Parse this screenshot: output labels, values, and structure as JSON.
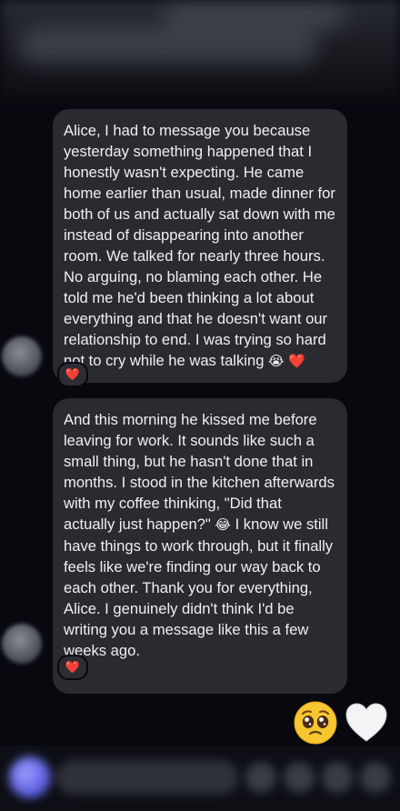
{
  "messages": [
    {
      "text": "Alice, I had to message you because yesterday something happened that I honestly wasn't expecting. He came home earlier than usual, made dinner for both of us and actually sat down with me instead of disappearing into another room. We talked for nearly three hours. No arguing, no blaming each other. He told me he'd been thinking a lot about everything and that he doesn't want our relationship to end. I was trying so hard not to cry while he was talking ",
      "trailing_emojis": [
        "😭",
        "❤️"
      ],
      "reaction": "❤️"
    },
    {
      "text_part1": "And this morning he kissed me before leaving for work. It sounds like such a small thing, but he hasn't done that in months. I stood in the kitchen afterwards with my coffee thinking, \"Did that actually just happen?\" ",
      "mid_emoji": "😂",
      "text_part2": " I know we still have things to work through, but it finally feels like we're finding our way back to each other. Thank you for everything, Alice. I genuinely didn't think I'd be writing you a message like this a few weeks ago.",
      "trailing_emoji": "❤️",
      "reaction": "❤️"
    }
  ],
  "reply_emojis": [
    "pleading-face",
    "white-heart"
  ],
  "colors": {
    "background": "#07090f",
    "bubble": "#2a2b31",
    "text": "#eef0f4",
    "heart": "#e63946"
  }
}
